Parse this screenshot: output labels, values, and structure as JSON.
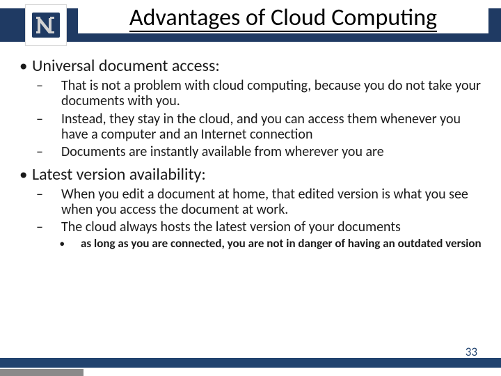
{
  "header": {
    "title": "Advantages of Cloud Computing",
    "logo_alt": "University N logo"
  },
  "body": {
    "lvl1_a": "Universal document access:",
    "lvl1_a_subs": [
      "That is not a problem with cloud computing, because you do not take your documents with you.",
      "Instead, they stay in the cloud, and you can access them whenever you have a computer and an Internet connection",
      "Documents are instantly available from wherever you are"
    ],
    "lvl1_b": "Latest version availability:",
    "lvl1_b_subs": [
      "When you edit a document at home, that edited version is what you see when you access the document at work.",
      "The cloud always hosts the latest version of your documents"
    ],
    "lvl1_b_subsubs": [
      "as long as you are connected, you are not in danger of having an outdated version"
    ]
  },
  "footer": {
    "page_number": "33"
  }
}
